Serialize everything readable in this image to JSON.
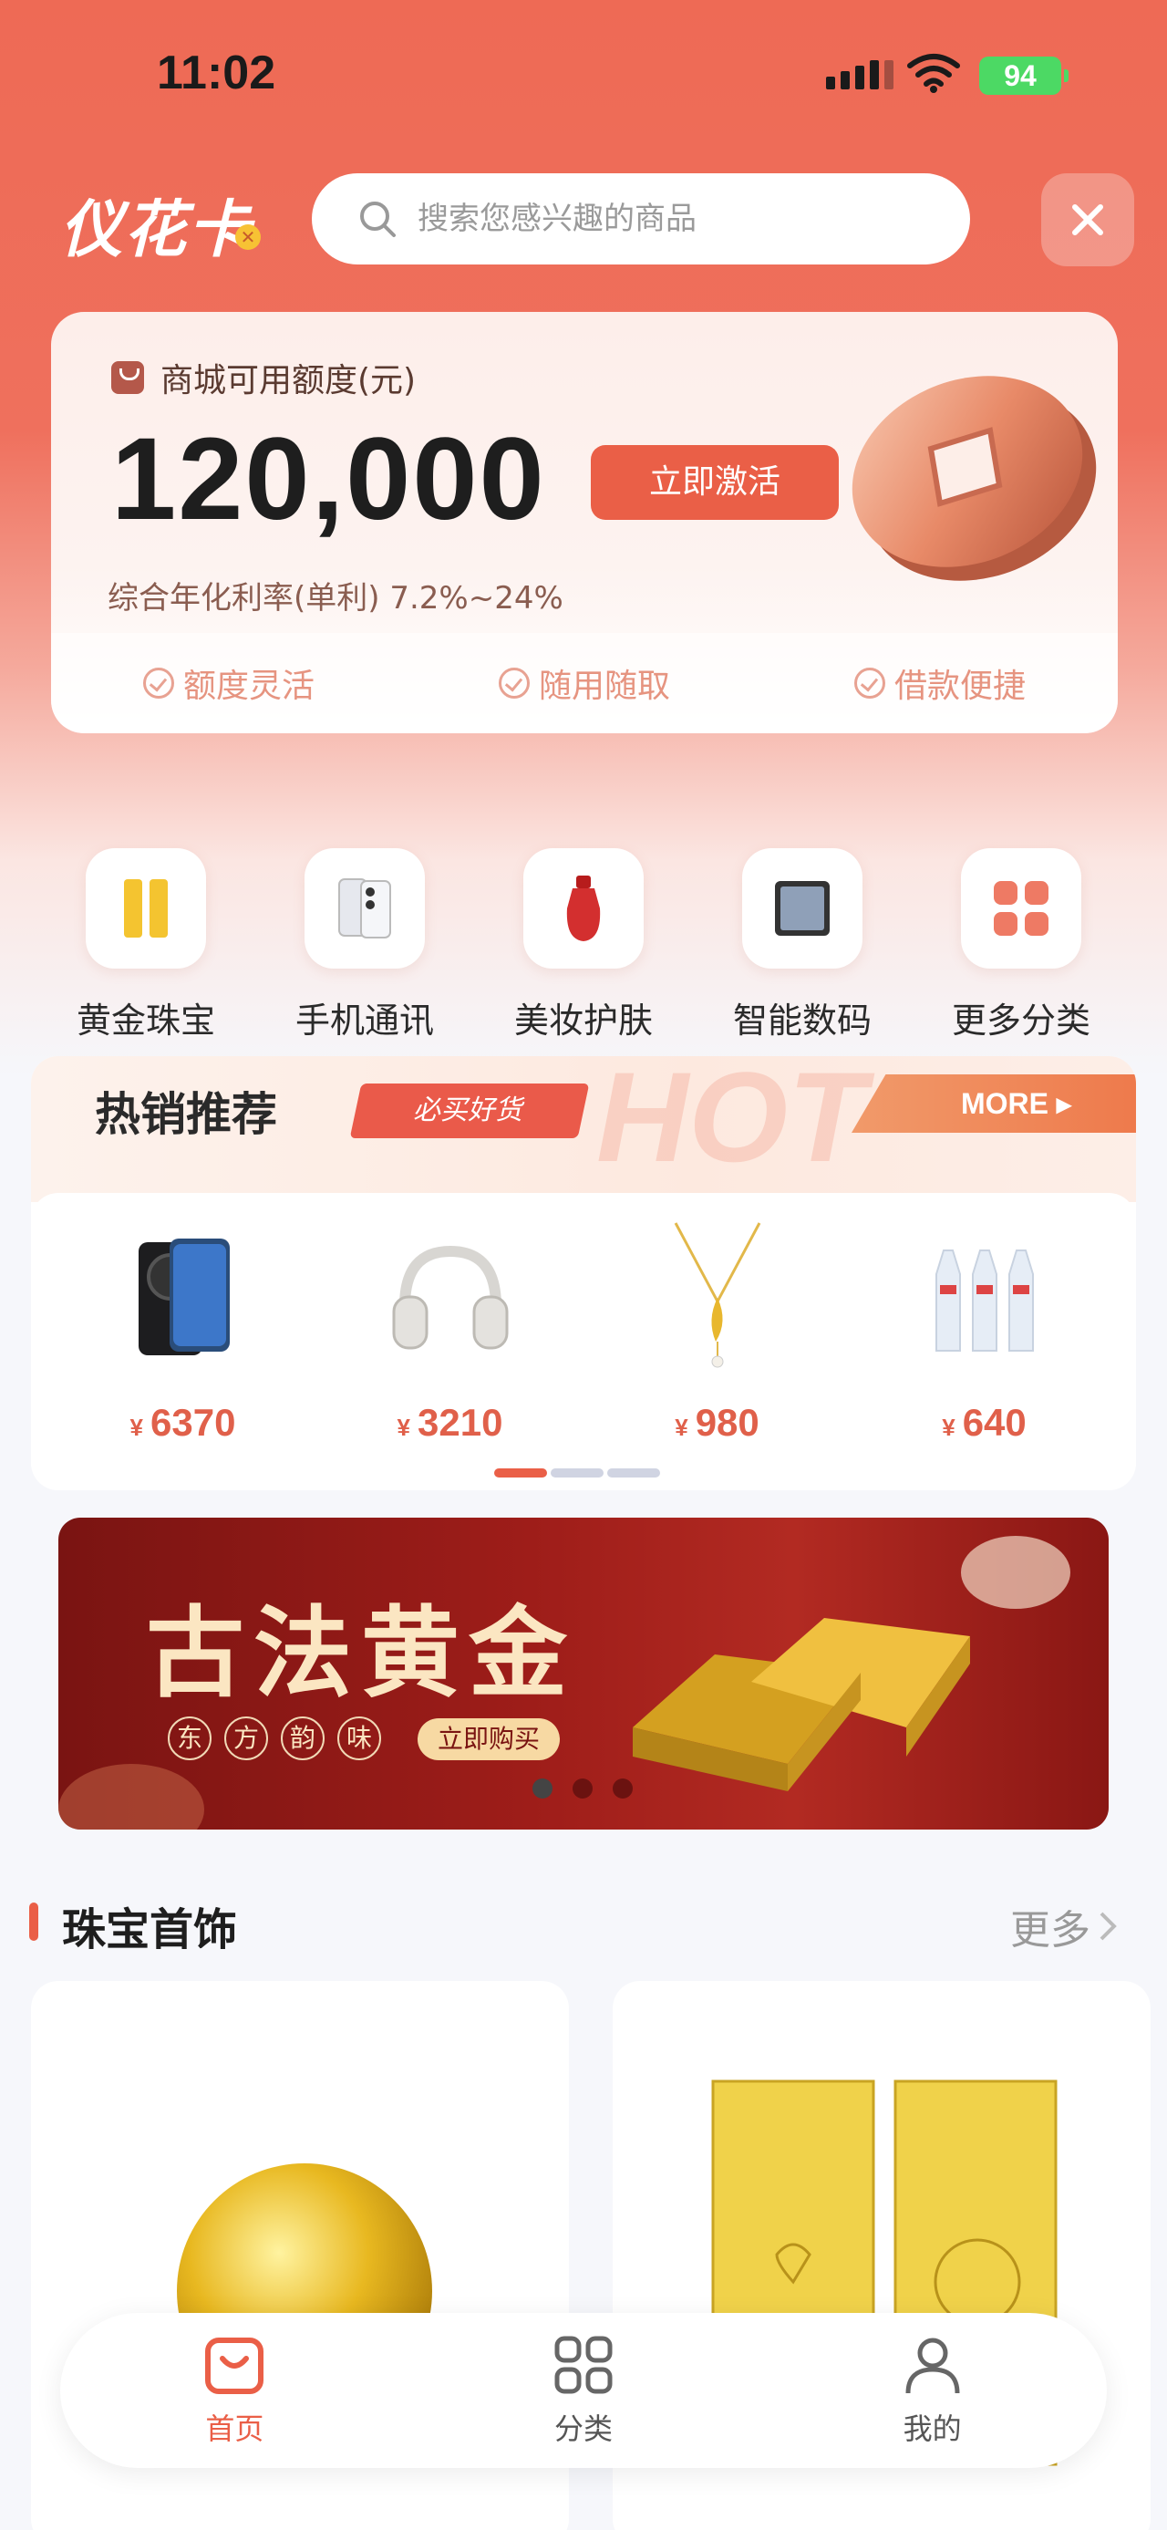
{
  "status": {
    "time": "11:02",
    "battery": "94"
  },
  "header": {
    "logo": "仪花卡",
    "search_placeholder": "搜索您感兴趣的商品"
  },
  "credit": {
    "label": "商城可用额度(元)",
    "amount": "120,000",
    "activate_label": "立即激活",
    "rate_text": "综合年化利率(单利) 7.2%~24%",
    "features": [
      "额度灵活",
      "随用随取",
      "借款便捷"
    ]
  },
  "categories": [
    {
      "name": "黄金珠宝",
      "icon": "gold-bar-icon"
    },
    {
      "name": "手机通讯",
      "icon": "phone-icon"
    },
    {
      "name": "美妆护肤",
      "icon": "cosmetics-icon"
    },
    {
      "name": "智能数码",
      "icon": "tablet-icon"
    },
    {
      "name": "更多分类",
      "icon": "grid-icon"
    }
  ],
  "hot": {
    "title": "热销推荐",
    "tag": "必买好货",
    "hot_word": "HOT",
    "more_label": "MORE",
    "currency": "¥",
    "products": [
      {
        "name": "phone",
        "price": "6370"
      },
      {
        "name": "headphones",
        "price": "3210"
      },
      {
        "name": "necklace",
        "price": "980"
      },
      {
        "name": "skincare",
        "price": "640"
      }
    ],
    "page_count": 3,
    "active_page": 1
  },
  "banner": {
    "title": "古法黄金",
    "chars": [
      "东",
      "方",
      "韵",
      "味"
    ],
    "buy_label": "立即购买",
    "slide_count": 3,
    "active_slide": 1
  },
  "jewelry": {
    "title": "珠宝首饰",
    "more_label": "更多"
  },
  "tabbar": {
    "items": [
      {
        "label": "首页",
        "icon": "home-bag-icon",
        "active": true
      },
      {
        "label": "分类",
        "icon": "category-grid-icon",
        "active": false
      },
      {
        "label": "我的",
        "icon": "user-icon",
        "active": false
      }
    ]
  },
  "colors": {
    "accent": "#ea5f47",
    "header_bg": "#ee6a55",
    "price": "#e0604a"
  }
}
